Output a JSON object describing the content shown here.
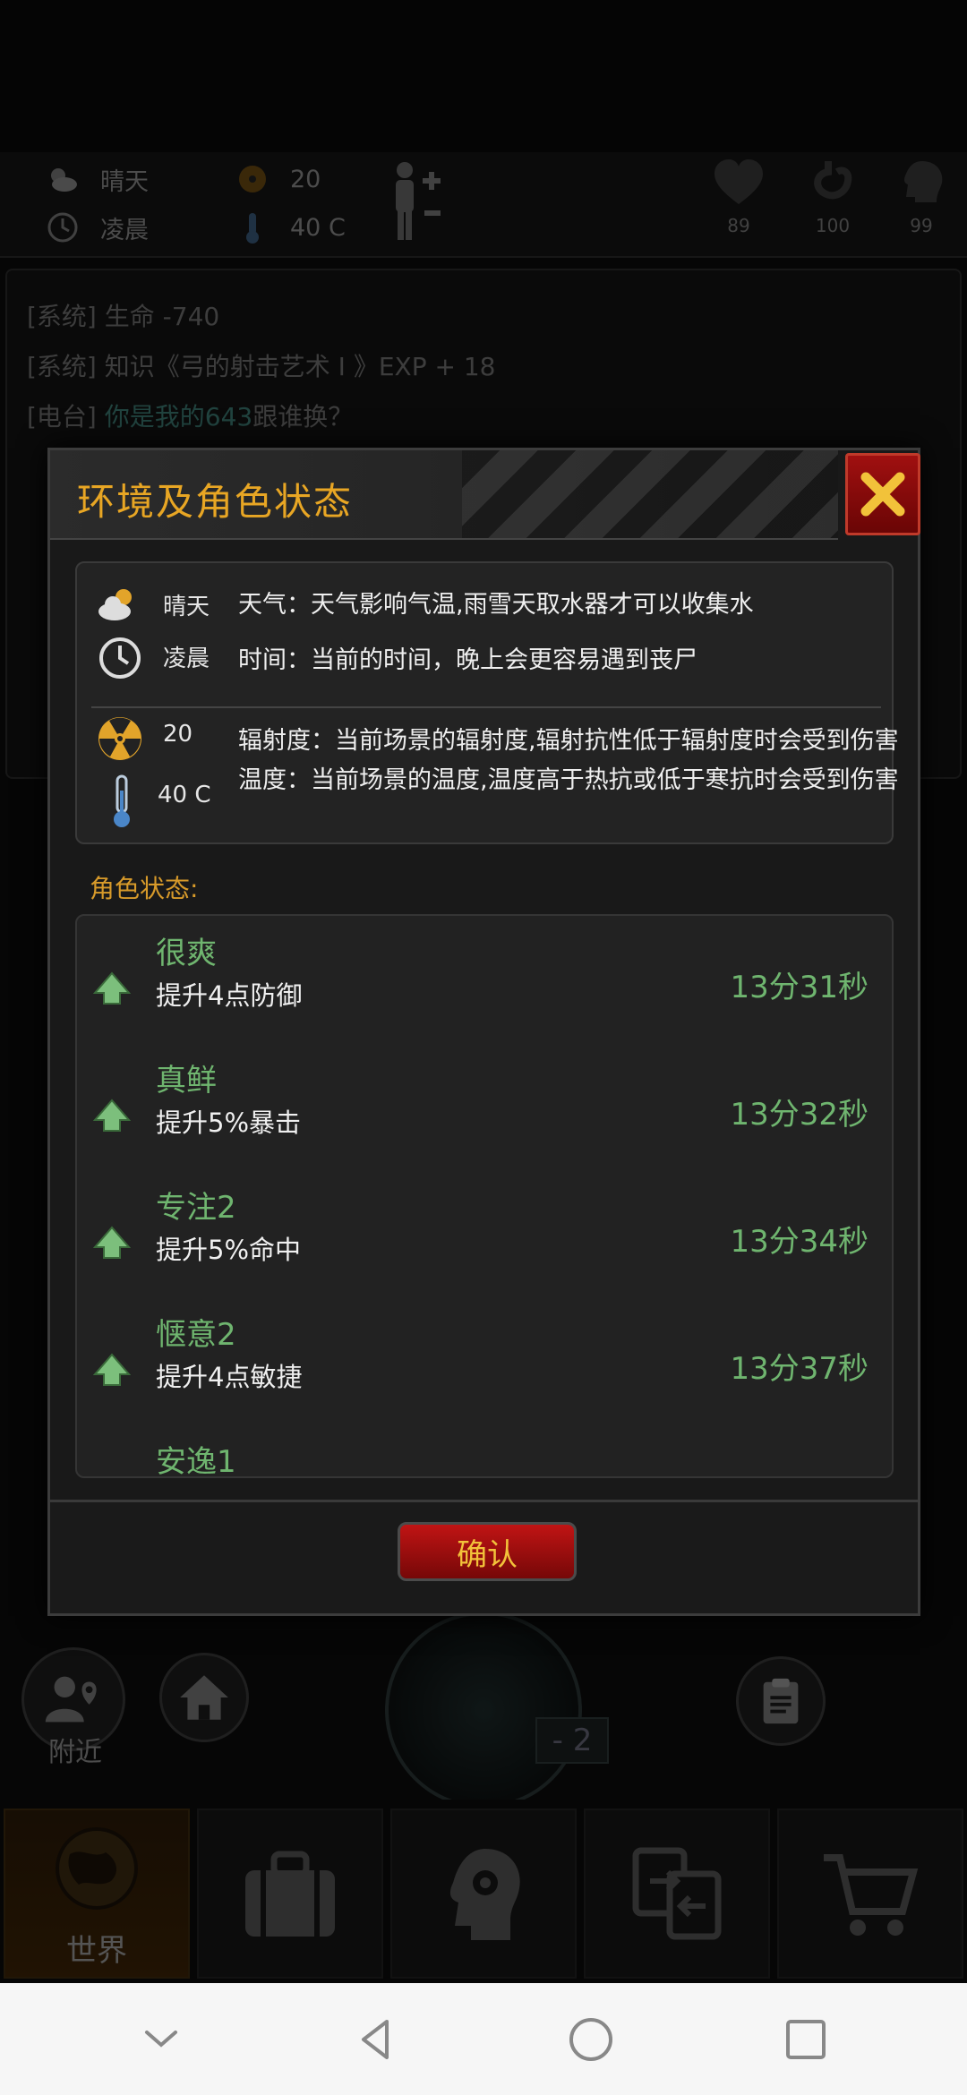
{
  "status_bar": {
    "weather": "晴天",
    "time_of_day": "凌晨",
    "radiation": "20",
    "temperature": "40 C",
    "vitals": [
      "89",
      "100",
      "99"
    ]
  },
  "log": [
    {
      "prefix": "[系统]",
      "text": "生命 -740",
      "highlight": ""
    },
    {
      "prefix": "[系统]",
      "text": "知识《弓的射击艺术 I 》EXP + 18",
      "highlight": ""
    },
    {
      "prefix": "[电台]",
      "text": "跟谁换？",
      "highlight": "你是我的643"
    }
  ],
  "dialog": {
    "title": "环境及角色状态",
    "env": {
      "weather_value": "晴天",
      "weather_desc": "天气：天气影响气温,雨雪天取水器才可以收集水",
      "time_value": "凌晨",
      "time_desc": "时间：当前的时间，晚上会更容易遇到丧尸",
      "radiation_value": "20",
      "radiation_desc": "辐射度：当前场景的辐射度,辐射抗性低于辐射度时会受到伤害",
      "temperature_value": "40 C",
      "temperature_desc": "温度：当前场景的温度,温度高于热抗或低于寒抗时会受到伤害"
    },
    "role_label": "角色状态:",
    "buffs": [
      {
        "name": "很爽",
        "effect": "提升4点防御",
        "time": "13分31秒"
      },
      {
        "name": "真鲜",
        "effect": "提升5%暴击",
        "time": "13分32秒"
      },
      {
        "name": "专注2",
        "effect": "提升5%命中",
        "time": "13分34秒"
      },
      {
        "name": "惬意2",
        "effect": "提升4点敏捷",
        "time": "13分37秒"
      },
      {
        "name": "安逸1",
        "effect": "",
        "time": ""
      }
    ],
    "confirm_label": "确认"
  },
  "quick": {
    "nearby_label": "附近",
    "radar_value": "- 2"
  },
  "nav": {
    "world_label": "世界"
  },
  "colors": {
    "title": "#e8a624",
    "buff_green": "#6fb56f",
    "confirm_red": "#c01414"
  }
}
